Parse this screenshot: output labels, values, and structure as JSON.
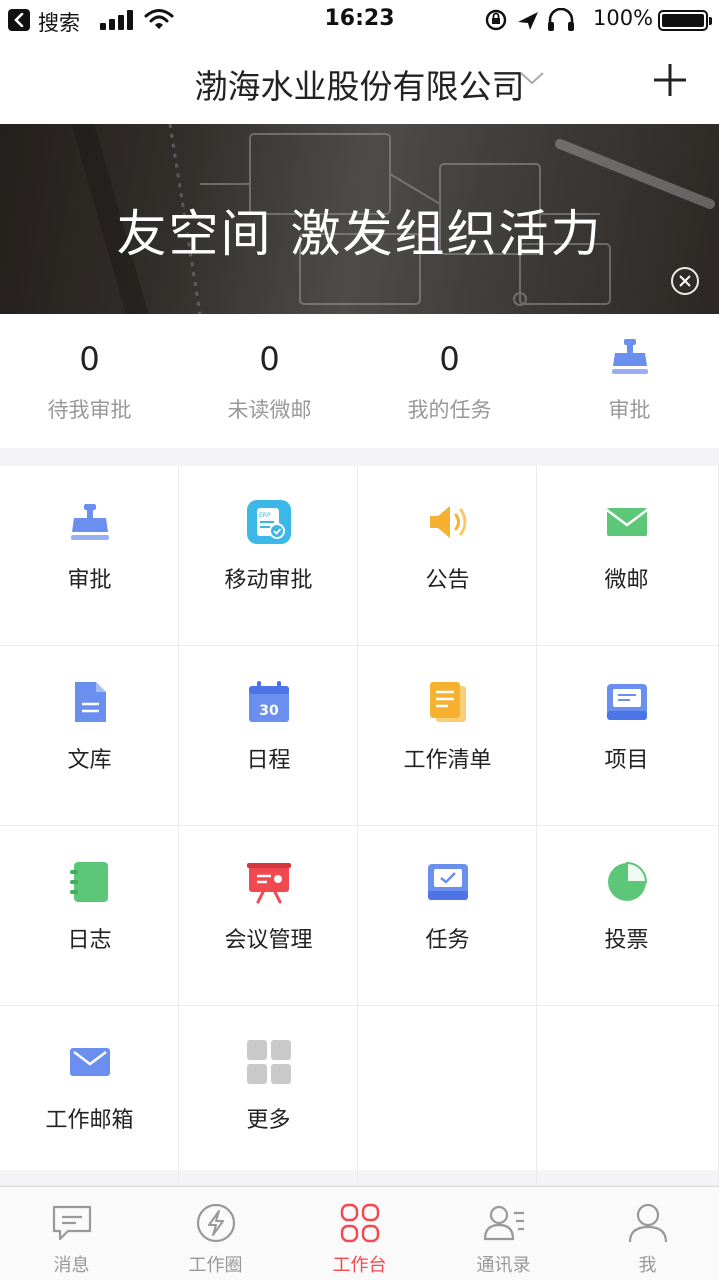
{
  "status_bar": {
    "back_label": "搜索",
    "time": "16:23",
    "battery": "100%",
    "battery_level": 1.0
  },
  "header": {
    "org_name": "渤海水业股份有限公司"
  },
  "banner": {
    "text": "友空间  激发组织活力"
  },
  "stats": [
    {
      "value": "0",
      "label": "待我审批"
    },
    {
      "value": "0",
      "label": "未读微邮"
    },
    {
      "value": "0",
      "label": "我的任务"
    },
    {
      "label": "审批",
      "icon": "approval-stamp-icon"
    }
  ],
  "apps": [
    {
      "label": "审批",
      "icon": "approval-stamp-icon",
      "color": "#6b8fef"
    },
    {
      "label": "移动审批",
      "icon": "erp-icon",
      "color": "#3bb8e8"
    },
    {
      "label": "公告",
      "icon": "speaker-icon",
      "color": "#f5b12f"
    },
    {
      "label": "微邮",
      "icon": "mail-icon",
      "color": "#5cc778"
    },
    {
      "label": "文库",
      "icon": "document-icon",
      "color": "#6b8fef"
    },
    {
      "label": "日程",
      "icon": "calendar-icon",
      "color": "#6b8fef",
      "calendar_day": "30"
    },
    {
      "label": "工作清单",
      "icon": "checklist-icon",
      "color": "#f5b12f"
    },
    {
      "label": "项目",
      "icon": "project-icon",
      "color": "#6b8fef"
    },
    {
      "label": "日志",
      "icon": "notebook-icon",
      "color": "#5cc778"
    },
    {
      "label": "会议管理",
      "icon": "presentation-icon",
      "color": "#f0494f"
    },
    {
      "label": "任务",
      "icon": "task-inbox-icon",
      "color": "#6b8fef"
    },
    {
      "label": "投票",
      "icon": "pie-chart-icon",
      "color": "#5cc778"
    },
    {
      "label": "工作邮箱",
      "icon": "envelope-icon",
      "color": "#6b8fef"
    },
    {
      "label": "更多",
      "icon": "more-grid-icon",
      "color": "#c9c9c9"
    }
  ],
  "tabs": [
    {
      "label": "消息",
      "icon": "chat-icon",
      "active": false
    },
    {
      "label": "工作圈",
      "icon": "lightning-icon",
      "active": false
    },
    {
      "label": "工作台",
      "icon": "workbench-icon",
      "active": true
    },
    {
      "label": "通讯录",
      "icon": "contacts-icon",
      "active": false
    },
    {
      "label": "我",
      "icon": "person-icon",
      "active": false
    }
  ],
  "colors": {
    "accent": "#f0494f",
    "inactive_tab": "#999999"
  }
}
